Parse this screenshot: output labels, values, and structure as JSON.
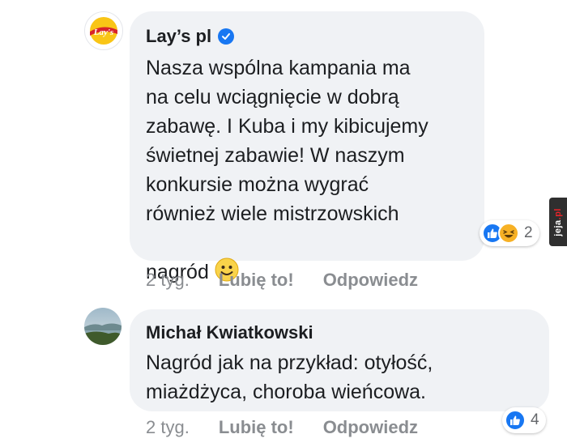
{
  "comments": [
    {
      "author": "Lay’s pl",
      "verified": true,
      "text": "Nasza wspólna kampania ma\nna celu wciągnięcie w dobrą\nzabawę. I Kuba i my kibicujemy\nświetnej zabawie! W naszym\nkonkursie można wygrać\nrównież wiele mistrzowskich\nnagród",
      "emoji": "🙂",
      "time": "2 tyg.",
      "like_label": "Lubię to!",
      "reply_label": "Odpowiedz",
      "reaction_count": "2",
      "reactions": [
        "like-icon",
        "haha-icon"
      ],
      "avatar_logo": "Lay's"
    },
    {
      "author": "Michał Kwiatkowski",
      "verified": false,
      "text": "Nagród jak na przykład: otyłość,\nmiażdżyca, choroba wieńcowa.",
      "time": "2 tyg.",
      "like_label": "Lubię to!",
      "reply_label": "Odpowiedz",
      "reaction_count": "4",
      "reactions": [
        "like-icon"
      ]
    }
  ],
  "watermark": {
    "main": "jeja",
    "suffix": ".pl"
  },
  "colors": {
    "bubble": "#f0f2f5",
    "like": "#1877f2",
    "haha": "#f7b125",
    "meta": "#8a8d91"
  }
}
